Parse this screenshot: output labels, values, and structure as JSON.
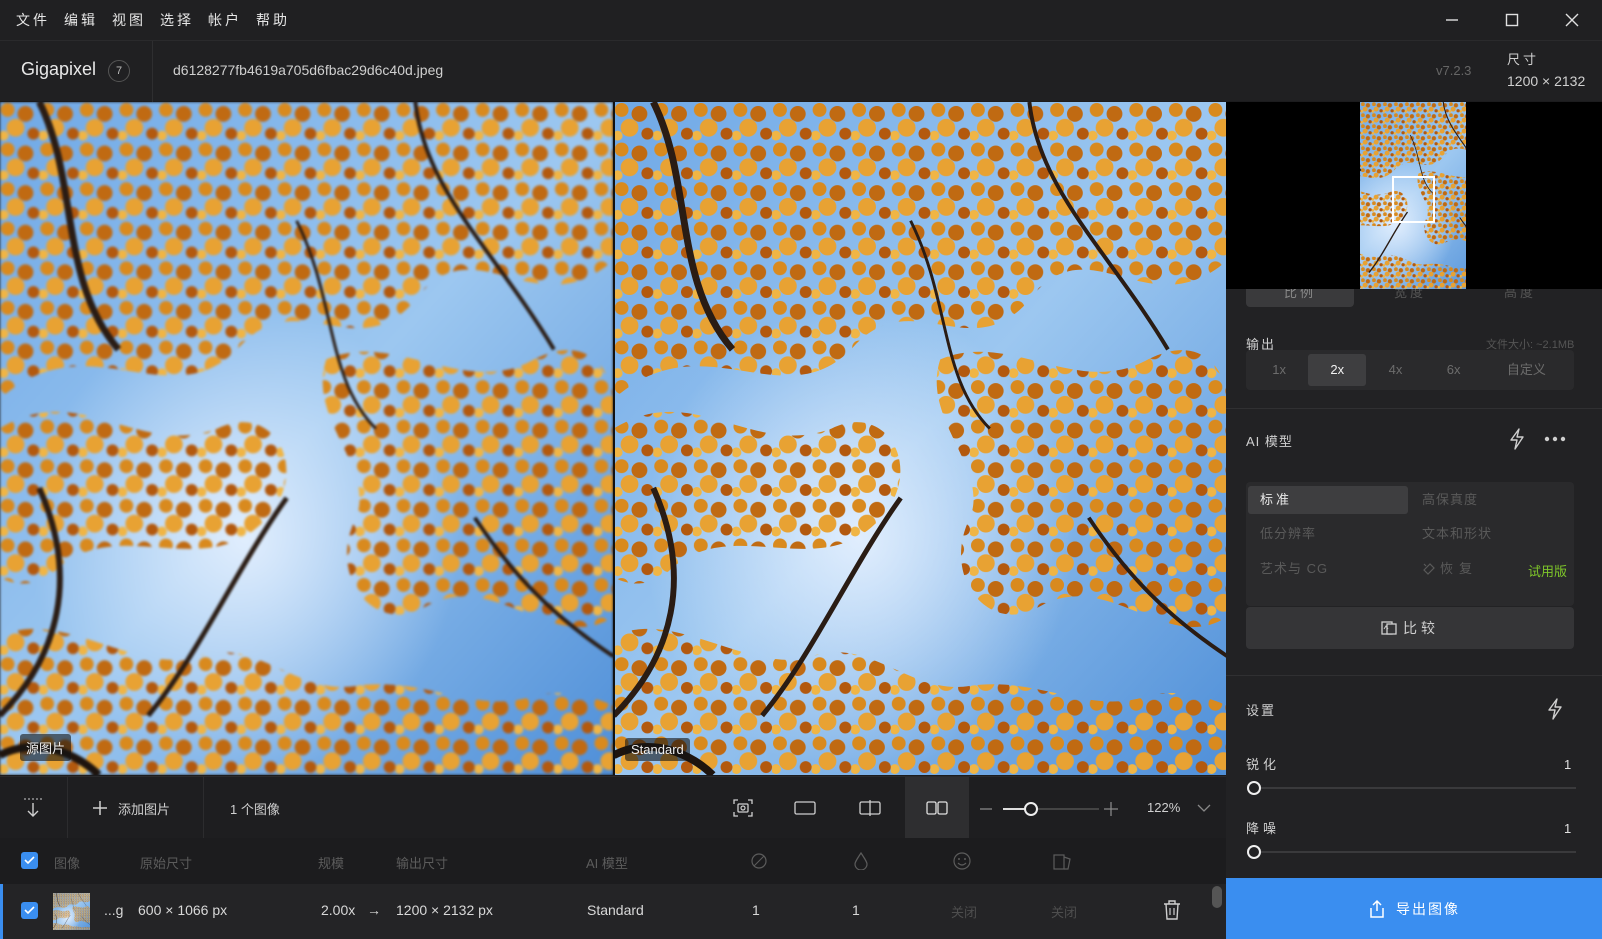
{
  "menu": [
    "文件",
    "编辑",
    "视图",
    "选择",
    "帐户",
    "帮助"
  ],
  "header": {
    "app_name": "Gigapixel",
    "badge_count": "7",
    "filename": "d6128277fb4619a705d6fbac29d6c40d.jpeg",
    "version": "v7.2.3",
    "size_label": "尺寸",
    "size_value": "1200 × 2132"
  },
  "preview": {
    "left_label": "源图片",
    "right_label": "Standard"
  },
  "panel": {
    "dimension_tabs": [
      "比例",
      "宽度",
      "高度"
    ],
    "output_label": "输出",
    "file_size": "文件大小: ~2.1MB",
    "scale_options": [
      "1x",
      "2x",
      "4x",
      "6x",
      "自定义"
    ],
    "scale_selected": "2x",
    "ai_model_label": "AI 模型",
    "models": [
      "标准",
      "高保真度",
      "低分辨率",
      "文本和形状",
      "艺术与 CG",
      "恢复"
    ],
    "model_selected": "标准",
    "trial_label": "试用版",
    "compare_label": "比较",
    "settings_label": "设置",
    "sharpen_label": "锐化",
    "sharpen_value": "1",
    "denoise_label": "降噪",
    "denoise_value": "1",
    "export_label": "导出图像"
  },
  "toolbar": {
    "add_image": "添加图片",
    "image_count": "1 个图像",
    "zoom_percent": "122%"
  },
  "table": {
    "headers": {
      "image": "图像",
      "original_size": "原始尺寸",
      "scale": "规模",
      "output_size": "输出尺寸",
      "ai_model": "AI 模型"
    },
    "row": {
      "name": "...g",
      "original": "600 × 1066 px",
      "scale": "2.00x",
      "arrow": "→",
      "output": "1200 × 2132 px",
      "model": "Standard",
      "v1": "1",
      "v2": "1",
      "v3": "关闭",
      "v4": "关闭"
    }
  },
  "colors": {
    "accent": "#3a8ef0",
    "trial": "#7ec62a",
    "background": "#1c1c1e"
  }
}
